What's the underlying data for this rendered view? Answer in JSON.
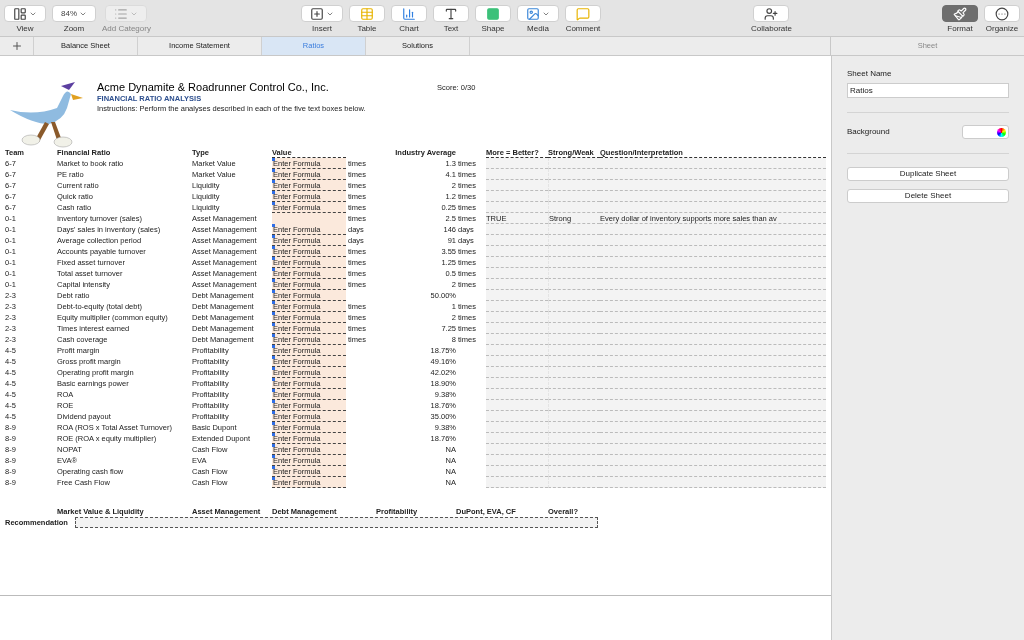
{
  "toolbar": {
    "items": [
      {
        "kind": "view",
        "label": "View"
      },
      {
        "kind": "zoom",
        "label": "Zoom",
        "value": "84%"
      },
      {
        "kind": "category",
        "label": "Add Category",
        "disabled": true
      },
      {
        "kind": "insert",
        "label": "Insert"
      },
      {
        "kind": "table",
        "label": "Table"
      },
      {
        "kind": "chart",
        "label": "Chart"
      },
      {
        "kind": "text",
        "label": "Text"
      },
      {
        "kind": "shape",
        "label": "Shape"
      },
      {
        "kind": "media",
        "label": "Media"
      },
      {
        "kind": "comment",
        "label": "Comment"
      },
      {
        "kind": "collaborate",
        "label": "Collaborate"
      },
      {
        "kind": "format",
        "label": "Format",
        "selected": true
      },
      {
        "kind": "organize",
        "label": "Organize",
        "selected": false
      }
    ]
  },
  "tabs": [
    {
      "label": "Balance Sheet",
      "selected": false
    },
    {
      "label": "Income Statement",
      "selected": false
    },
    {
      "label": "Ratios",
      "selected": true
    },
    {
      "label": "Solutions",
      "selected": false
    }
  ],
  "sheet": {
    "title": "Acme Dynamite & Roadrunner Control Co., Inc.",
    "subtitle": "FINANCIAL RATIO ANALYSIS",
    "instructions": "Instructions: Perform the analyses described in each of the five text boxes below.",
    "score": "Score: 0/30",
    "columns": [
      "Team",
      "Financial Ratio",
      "Type",
      "Value",
      "Industry Average",
      "More = Better?",
      "Strong/Weak",
      "Question/Interpretation"
    ],
    "rows": [
      {
        "team": "6-7",
        "ratio": "Market to book ratio",
        "type": "Market Value",
        "value": "Enter Formula",
        "unit": "times",
        "avg": "1.3",
        "avg_unit": "times"
      },
      {
        "team": "6-7",
        "ratio": "PE ratio",
        "type": "Market Value",
        "value": "Enter Formula",
        "unit": "times",
        "avg": "4.1",
        "avg_unit": "times"
      },
      {
        "team": "6-7",
        "ratio": "Current ratio",
        "type": "Liquidity",
        "value": "Enter Formula",
        "unit": "times",
        "avg": "2",
        "avg_unit": "times"
      },
      {
        "team": "6-7",
        "ratio": "Quick ratio",
        "type": "Liquidity",
        "value": "Enter Formula",
        "unit": "times",
        "avg": "1.2",
        "avg_unit": "times"
      },
      {
        "team": "6-7",
        "ratio": "Cash ratio",
        "type": "Liquidity",
        "value": "Enter Formula",
        "unit": "times",
        "avg": "0.25",
        "avg_unit": "times"
      },
      {
        "team": "0-1",
        "ratio": "Inventory turnover (sales)",
        "type": "Asset Management",
        "unit": "times",
        "avg": "2.5",
        "avg_unit": "times",
        "more": "TRUE",
        "strong": "Strong",
        "interp": "Every dollar of inventory supports more sales than av"
      },
      {
        "team": "0-1",
        "ratio": "Days' sales in inventory (sales)",
        "type": "Asset Management",
        "value": "Enter Formula",
        "unit": "days",
        "avg": "146",
        "avg_unit": "days"
      },
      {
        "team": "0-1",
        "ratio": "Average collection period",
        "type": "Asset Management",
        "value": "Enter Formula",
        "unit": "days",
        "avg": "91",
        "avg_unit": "days"
      },
      {
        "team": "0-1",
        "ratio": "Accounts payable turnover",
        "type": "Asset Management",
        "value": "Enter Formula",
        "unit": "times",
        "avg": "3.55",
        "avg_unit": "times"
      },
      {
        "team": "0-1",
        "ratio": "Fixed asset turnover",
        "type": "Asset Management",
        "value": "Enter Formula",
        "unit": "times",
        "avg": "1.25",
        "avg_unit": "times"
      },
      {
        "team": "0-1",
        "ratio": "Total asset turnover",
        "type": "Asset Management",
        "value": "Enter Formula",
        "unit": "times",
        "avg": "0.5",
        "avg_unit": "times"
      },
      {
        "team": "0-1",
        "ratio": "Capital intensity",
        "type": "Asset Management",
        "value": "Enter Formula",
        "unit": "times",
        "avg": "2",
        "avg_unit": "times"
      },
      {
        "team": "2-3",
        "ratio": "Debt ratio",
        "type": "Debt Management",
        "value": "Enter Formula",
        "avg": "50.00%"
      },
      {
        "team": "2-3",
        "ratio": "Debt-to-equity (total debt)",
        "type": "Debt Management",
        "value": "Enter Formula",
        "unit": "times",
        "avg": "1",
        "avg_unit": "times"
      },
      {
        "team": "2-3",
        "ratio": "Equity multiplier (common equity)",
        "type": "Debt Management",
        "value": "Enter Formula",
        "unit": "times",
        "avg": "2",
        "avg_unit": "times"
      },
      {
        "team": "2-3",
        "ratio": "Times interest earned",
        "type": "Debt Management",
        "value": "Enter Formula",
        "unit": "times",
        "avg": "7.25",
        "avg_unit": "times"
      },
      {
        "team": "2-3",
        "ratio": "Cash coverage",
        "type": "Debt Management",
        "value": "Enter Formula",
        "unit": "times",
        "avg": "8",
        "avg_unit": "times"
      },
      {
        "team": "4-5",
        "ratio": "Profit margin",
        "type": "Profitability",
        "value": "Enter Formula",
        "avg": "18.75%"
      },
      {
        "team": "4-5",
        "ratio": "Gross profit margin",
        "type": "Profitability",
        "value": "Enter Formula",
        "avg": "49.16%"
      },
      {
        "team": "4-5",
        "ratio": "Operating profit margin",
        "type": "Profitability",
        "value": "Enter Formula",
        "avg": "42.02%"
      },
      {
        "team": "4-5",
        "ratio": "Basic earnings power",
        "type": "Profitability",
        "value": "Enter Formula",
        "avg": "18.90%"
      },
      {
        "team": "4-5",
        "ratio": "ROA",
        "type": "Profitability",
        "value": "Enter Formula",
        "avg": "9.38%"
      },
      {
        "team": "4-5",
        "ratio": "ROE",
        "type": "Profitability",
        "value": "Enter Formula",
        "avg": "18.76%"
      },
      {
        "team": "4-5",
        "ratio": "Dividend payout",
        "type": "Profitability",
        "value": "Enter Formula",
        "avg": "35.00%"
      },
      {
        "team": "8-9",
        "ratio": "ROA (ROS x Total Asset Turnover)",
        "type": "Basic Dupont",
        "value": "Enter Formula",
        "avg": "9.38%"
      },
      {
        "team": "8-9",
        "ratio": "ROE (ROA x equity multiplier)",
        "type": "Extended Dupont",
        "value": "Enter Formula",
        "avg": "18.76%"
      },
      {
        "team": "8-9",
        "ratio": "NOPAT",
        "type": "Cash Flow",
        "value": "Enter Formula",
        "avg": "NA"
      },
      {
        "team": "8-9",
        "ratio": "EVA®",
        "type": "EVA",
        "value": "Enter Formula",
        "avg": "NA"
      },
      {
        "team": "8-9",
        "ratio": "Operating cash flow",
        "type": "Cash Flow",
        "value": "Enter Formula",
        "avg": "NA"
      },
      {
        "team": "8-9",
        "ratio": "Free Cash Flow",
        "type": "Cash Flow",
        "value": "Enter Formula",
        "avg": "NA"
      }
    ],
    "recommendation": {
      "label": "Recommendation",
      "columns": [
        "Market Value & Liquidity",
        "Asset Management",
        "Debt Management",
        "Profitability",
        "DuPont, EVA, CF",
        "Overall?"
      ]
    }
  },
  "inspector": {
    "header": "Sheet",
    "sheet_name_label": "Sheet Name",
    "sheet_name": "Ratios",
    "background_label": "Background",
    "buttons": [
      "Duplicate Sheet",
      "Delete Sheet"
    ]
  }
}
